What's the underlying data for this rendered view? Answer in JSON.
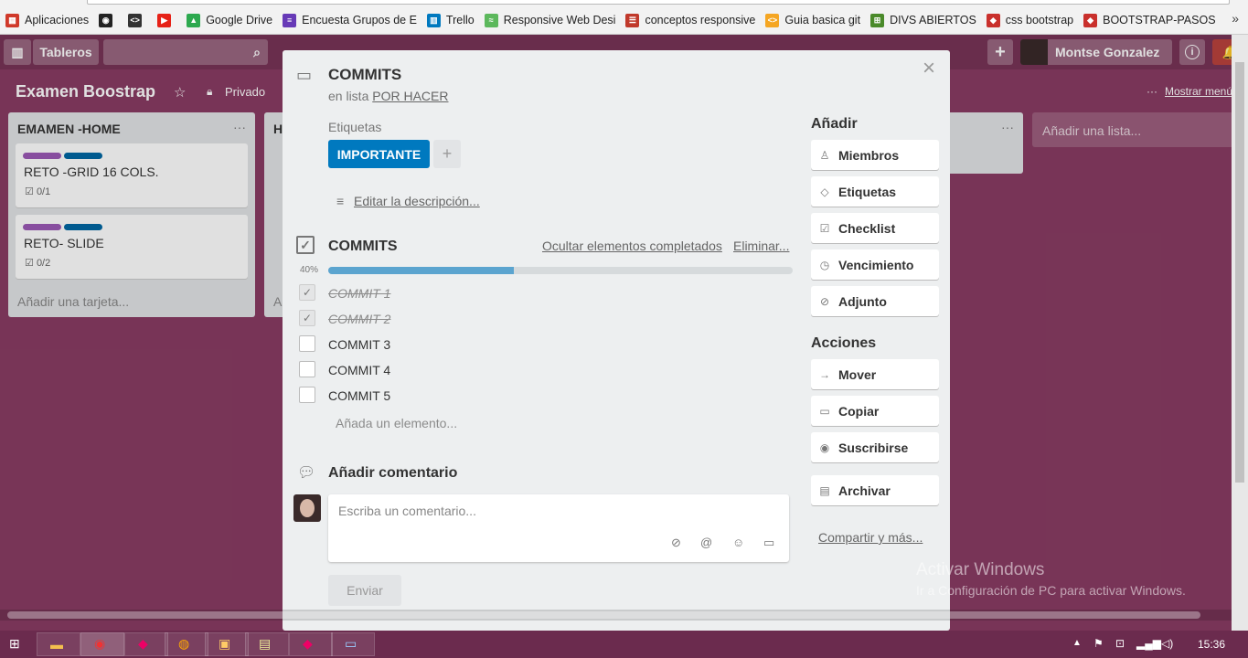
{
  "bookmarks": [
    {
      "label": "Aplicaciones",
      "color": "#d0392a",
      "glyph": "▦"
    },
    {
      "label": "",
      "color": "#222",
      "glyph": "◉"
    },
    {
      "label": "",
      "color": "#333",
      "glyph": "<>"
    },
    {
      "label": "",
      "color": "#e62117",
      "glyph": "▶"
    },
    {
      "label": "Google Drive",
      "color": "#2da94f",
      "glyph": "▲"
    },
    {
      "label": "Encuesta Grupos de E",
      "color": "#673ab7",
      "glyph": "≡"
    },
    {
      "label": "Trello",
      "color": "#0079bf",
      "glyph": "▥"
    },
    {
      "label": "Responsive Web Desi",
      "color": "#5cb85c",
      "glyph": "≈"
    },
    {
      "label": "conceptos responsive",
      "color": "#c0392b",
      "glyph": "☰"
    },
    {
      "label": "Guia basica git",
      "color": "#f5a623",
      "glyph": "<>"
    },
    {
      "label": "DIVS ABIERTOS",
      "color": "#4a8a2a",
      "glyph": "⊞"
    },
    {
      "label": "css bootstrap",
      "color": "#c9302c",
      "glyph": "◆"
    },
    {
      "label": "BOOTSTRAP-PASOS",
      "color": "#c9302c",
      "glyph": "◆"
    }
  ],
  "bookmarks_more": "»",
  "header": {
    "boards_label": "Tableros",
    "user_name": "Montse Gonzalez",
    "board_name": "Examen Boostrap",
    "visibility": "Privado",
    "show_menu": "Mostrar menú",
    "add": "+",
    "info": "i"
  },
  "lists": [
    {
      "title": "EMAMEN -HOME",
      "cards": [
        {
          "title": "RETO -GRID 16 COLS.",
          "badge": "0/1",
          "labels": [
            "#9b59b6",
            "#0067a3"
          ]
        },
        {
          "title": "RETO- SLIDE",
          "badge": "0/2",
          "labels": [
            "#9b59b6",
            "#0067a3"
          ]
        }
      ],
      "add_card": "Añadir una tarjeta..."
    },
    {
      "title": "H",
      "add_card": "A"
    }
  ],
  "add_list": "Añadir una lista...",
  "modal": {
    "title": "COMMITS",
    "in_list_prefix": "en lista",
    "list_name": "POR HACER",
    "labels_heading": "Etiquetas",
    "label": "IMPORTANTE",
    "label_color": "#0079bf",
    "add_label": "+",
    "edit_description": "Editar la descripción...",
    "checklist": {
      "title": "COMMITS",
      "hide_completed": "Ocultar elementos completados",
      "delete": "Eliminar...",
      "percent_label": "40%",
      "progress": 0.4,
      "items": [
        {
          "text": "COMMIT 1",
          "done": true
        },
        {
          "text": "COMMIT 2",
          "done": true
        },
        {
          "text": "COMMIT 3",
          "done": false
        },
        {
          "text": "COMMIT 4",
          "done": false
        },
        {
          "text": "COMMIT 5",
          "done": false
        }
      ],
      "add_item": "Añada un elemento..."
    },
    "comment": {
      "heading": "Añadir comentario",
      "placeholder": "Escriba un comentario...",
      "send": "Enviar"
    },
    "sidebar": {
      "add_heading": "Añadir",
      "add_buttons": [
        "Miembros",
        "Etiquetas",
        "Checklist",
        "Vencimiento",
        "Adjunto"
      ],
      "actions_heading": "Acciones",
      "action_buttons": [
        "Mover",
        "Copiar",
        "Suscribirse"
      ],
      "archive": "Archivar",
      "share": "Compartir y más..."
    }
  },
  "watermark": {
    "title": "Activar Windows",
    "subtitle": "Ir a Configuración de PC para activar Windows."
  },
  "taskbar": {
    "time": "15:36"
  }
}
